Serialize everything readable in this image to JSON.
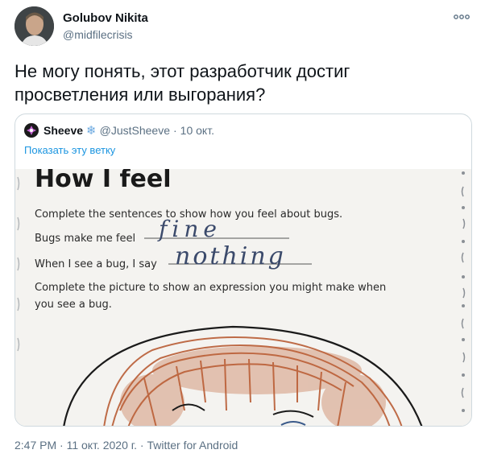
{
  "author": {
    "name": "Golubov Nikita",
    "handle": "@midfilecrisis"
  },
  "tweet": {
    "text": "Не могу понять, этот разработчик достиг просветления или выгорания?"
  },
  "quote": {
    "name": "Sheeve",
    "handle": "@JustSheeve",
    "separator": "·",
    "date": "10 окт.",
    "show_thread": "Показать эту ветку",
    "worksheet": {
      "title": "How I feel",
      "instruction1": "Complete the sentences to show how you feel about bugs.",
      "line1_label": "Bugs make me feel",
      "line1_answer": "fine",
      "line2_label": "When I see a bug, I say",
      "line2_answer": "nothing",
      "instruction2a": "Complete the picture to show an expression you might make when",
      "instruction2b": "you see a bug."
    }
  },
  "footer": {
    "meta": "2:47 PM · 11 окт. 2020 г. · Twitter for Android"
  },
  "icons": {
    "more": "more-horizontal-icon",
    "snowflake": "snowflake-icon"
  },
  "colors": {
    "link": "#1b95e0",
    "secondary": "#5b7083",
    "border": "#cfd9de"
  }
}
